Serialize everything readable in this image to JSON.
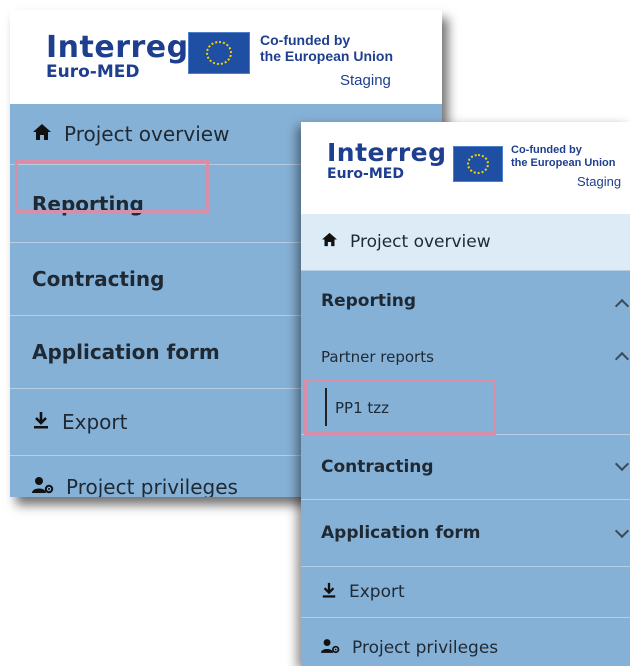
{
  "branding": {
    "program_name": "Interreg",
    "region": "Euro-MED",
    "cofunded_line1": "Co-funded by",
    "cofunded_line2": "the European Union",
    "environment": "Staging"
  },
  "left_panel": {
    "items": [
      {
        "label": "Project overview",
        "icon": "home-icon"
      },
      {
        "label": "Reporting"
      },
      {
        "label": "Contracting"
      },
      {
        "label": "Application form"
      },
      {
        "label": "Export",
        "icon": "download-icon"
      },
      {
        "label": "Project privileges",
        "icon": "user-gear-icon"
      }
    ]
  },
  "right_panel": {
    "items": [
      {
        "label": "Project overview",
        "icon": "home-icon"
      },
      {
        "label": "Reporting",
        "chevron": "up"
      },
      {
        "label": "Partner reports",
        "chevron": "up"
      },
      {
        "label": "PP1 tzz"
      },
      {
        "label": "Contracting",
        "chevron": "down"
      },
      {
        "label": "Application form",
        "chevron": "down"
      },
      {
        "label": "Export",
        "icon": "download-icon"
      },
      {
        "label": "Project privileges",
        "icon": "user-gear-icon"
      }
    ]
  },
  "colors": {
    "menu_bg": "#86b1d6",
    "active_bg": "#dcebf6",
    "highlight_border": "#d88ea8",
    "brand_blue": "#1e3f8f"
  }
}
